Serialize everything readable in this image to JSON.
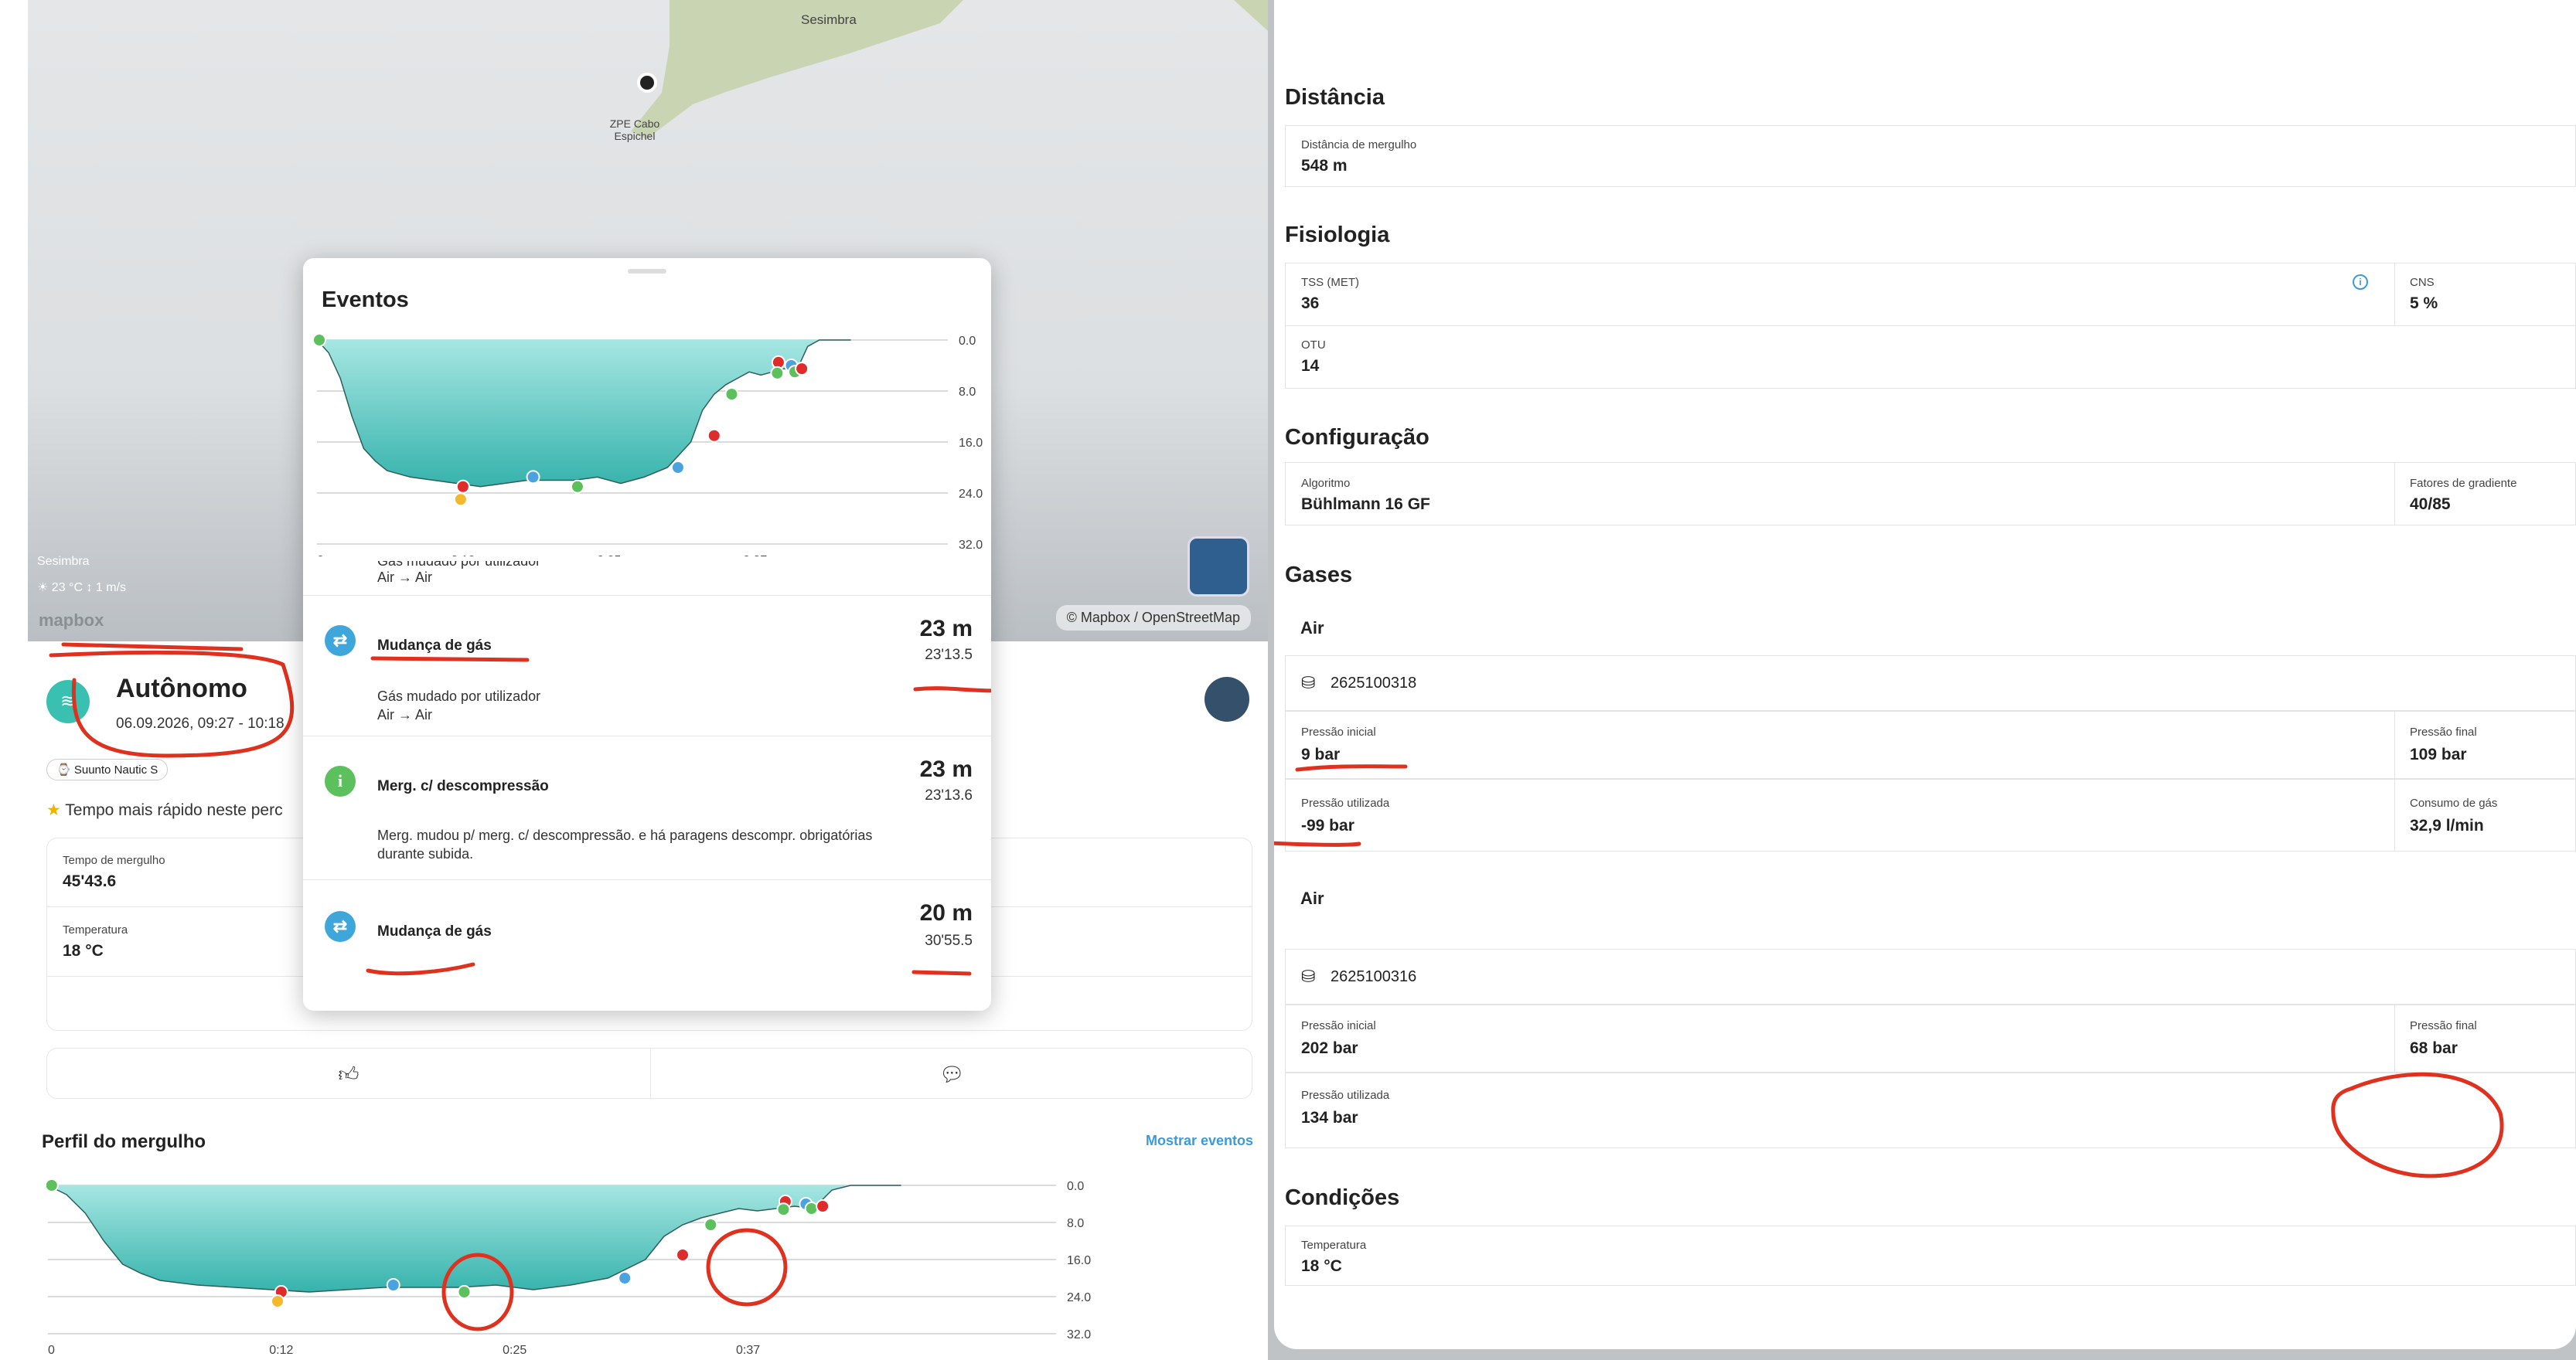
{
  "map": {
    "place_top": "Sesimbra",
    "poi_label": "ZPE Cabo Espichel",
    "bottom_place": "Sesimbra",
    "weather": "23 °C",
    "wind": "1 m/s",
    "logo": "mapbox",
    "attribution": "© Mapbox / OpenStreetMap"
  },
  "activity": {
    "title": "Autônomo",
    "datetime": "06.09.2026, 09:27 - 10:18",
    "device": "Suunto Nautic S",
    "achievement": "Tempo mais rápido neste perc"
  },
  "stats": [
    {
      "label": "Tempo de mergulho",
      "value": "45'43.6"
    },
    {
      "label": "Temperatura",
      "value": "18 °C"
    }
  ],
  "profile": {
    "title": "Perfil do mergulho",
    "show_events": "Mostrar eventos"
  },
  "chart_data": [
    {
      "type": "area",
      "title": "",
      "x_tick_labels": [
        "0",
        "0:12",
        "0:25",
        "0:37"
      ],
      "y_tick_labels": [
        "0.0",
        "8.0",
        "16.0",
        "24.0",
        "32.0"
      ],
      "ylim": [
        0,
        32
      ],
      "y_inverted": true,
      "grid": true,
      "series": [
        {
          "x_min": [
            0,
            1,
            2,
            3,
            4,
            5,
            6,
            8,
            10,
            12,
            14,
            16,
            18,
            20,
            22,
            24,
            26,
            28,
            30,
            32,
            33,
            34,
            35,
            36,
            37,
            38,
            39,
            40,
            41,
            42,
            43,
            44,
            45.7
          ],
          "depth_m": [
            0,
            2,
            6,
            12,
            17,
            19,
            20.5,
            21.5,
            22,
            22.5,
            23,
            22.5,
            22,
            22,
            22,
            21.5,
            22.5,
            21.5,
            20,
            16,
            11,
            8.5,
            7,
            6,
            5,
            5.5,
            5,
            4.5,
            5,
            1,
            0,
            0,
            0
          ]
        }
      ],
      "event_markers": [
        {
          "time_min": 0.2,
          "depth_m": 0,
          "color": "#5cc05c"
        },
        {
          "time_min": 12.5,
          "depth_m": 23,
          "color": "#e02b2b"
        },
        {
          "time_min": 12.3,
          "depth_m": 25,
          "color": "#f2b82e"
        },
        {
          "time_min": 18.5,
          "depth_m": 21.5,
          "color": "#4aa3df"
        },
        {
          "time_min": 22.3,
          "depth_m": 23,
          "color": "#5cc05c"
        },
        {
          "time_min": 30.9,
          "depth_m": 20,
          "color": "#4aa3df"
        },
        {
          "time_min": 34,
          "depth_m": 15,
          "color": "#e02b2b"
        },
        {
          "time_min": 35.5,
          "depth_m": 8.5,
          "color": "#5cc05c"
        },
        {
          "time_min": 39.5,
          "depth_m": 3.5,
          "color": "#e02b2b"
        },
        {
          "time_min": 39.4,
          "depth_m": 5.2,
          "color": "#5cc05c"
        },
        {
          "time_min": 40.6,
          "depth_m": 4,
          "color": "#4aa3df"
        },
        {
          "time_min": 40.9,
          "depth_m": 5,
          "color": "#5cc05c"
        },
        {
          "time_min": 41.5,
          "depth_m": 4.5,
          "color": "#e02b2b"
        }
      ]
    }
  ],
  "modal": {
    "title": "Eventos",
    "partial_text": "Gás mudado por utilizador",
    "partial_sub": "Air → Air",
    "events": [
      {
        "icon": "gas-change",
        "title": "Mudança de gás",
        "depth": "23 m",
        "time": "23'13.5",
        "desc": "Gás mudado por utilizador",
        "desc2": "Air → Air"
      },
      {
        "icon": "info",
        "title": "Merg. c/ descompressão",
        "depth": "23 m",
        "time": "23'13.6",
        "desc": "Merg. mudou p/ merg. c/ descompressão. e há paragens descompr. obrigatórias durante subida."
      },
      {
        "icon": "gas-change",
        "title": "Mudança de gás",
        "depth": "20 m",
        "time": "30'55.5"
      }
    ]
  },
  "right": {
    "distance": {
      "title": "Distância",
      "label": "Distância de mergulho",
      "value": "548 m"
    },
    "physiology": {
      "title": "Fisiologia",
      "tss_label": "TSS (MET)",
      "tss_value": "36",
      "cns_label": "CNS",
      "cns_value": "5 %",
      "otu_label": "OTU",
      "otu_value": "14"
    },
    "config": {
      "title": "Configuração",
      "algo_label": "Algoritmo",
      "algo_value": "Bühlmann 16 GF",
      "gf_label": "Fatores de gradiente",
      "gf_value": "40/85"
    },
    "gases": {
      "title": "Gases",
      "tanks": [
        {
          "gas": "Air",
          "id": "2625100318",
          "start_label": "Pressão inicial",
          "start": "9 bar",
          "end_label": "Pressão final",
          "end": "109 bar",
          "used_label": "Pressão utilizada",
          "used": "-99 bar",
          "cons_label": "Consumo de gás",
          "cons": "32,9 l/min"
        },
        {
          "gas": "Air",
          "id": "2625100316",
          "start_label": "Pressão inicial",
          "start": "202 bar",
          "end_label": "Pressão final",
          "end": "68 bar",
          "used_label": "Pressão utilizada",
          "used": "134 bar"
        }
      ]
    },
    "conditions": {
      "title": "Condições",
      "label": "Temperatura",
      "value": "18 °C"
    }
  },
  "colors": {
    "accent": "#3d9ad8",
    "annotation": "#e0301e",
    "area_top": "#a6e6e2",
    "area_bottom": "#36b3ac"
  }
}
